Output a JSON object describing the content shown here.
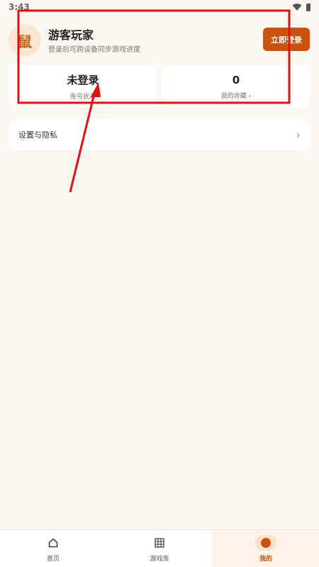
{
  "status_bar": {
    "time": "3:43"
  },
  "profile": {
    "avatar_char": "鼠",
    "name": "游客玩家",
    "subtitle": "登录后可跨设备同步游戏进度",
    "login_button": "立即登录"
  },
  "stats": {
    "account": {
      "value": "未登录",
      "label": "账号状态"
    },
    "favorites": {
      "value": "0",
      "label": "我的收藏 ›"
    }
  },
  "settings": {
    "label": "设置与隐私",
    "chevron": "›"
  },
  "bottom_nav": {
    "items": [
      {
        "label": "首页",
        "icon": "home-icon",
        "active": false
      },
      {
        "label": "游戏库",
        "icon": "grid-icon",
        "active": false
      },
      {
        "label": "我的",
        "icon": "profile-dot-icon",
        "active": true
      }
    ]
  },
  "colors": {
    "accent": "#c9520e",
    "background": "#fdf7f2",
    "annotation_red": "#e01010"
  }
}
